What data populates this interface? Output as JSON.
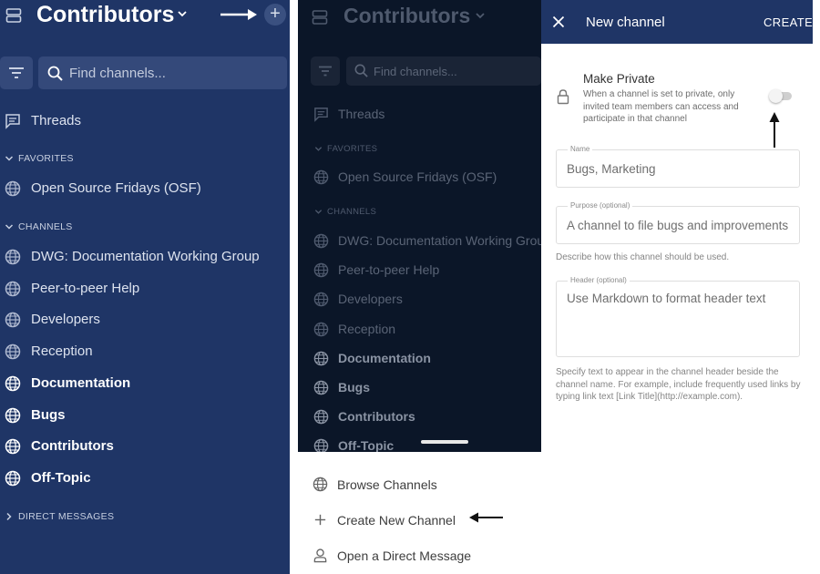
{
  "sidebar": {
    "team_name": "Contributors",
    "search_placeholder": "Find channels...",
    "threads_label": "Threads",
    "favorites_header": "FAVORITES",
    "favorites": [
      {
        "label": "Open Source Fridays (OSF)",
        "bold": false
      }
    ],
    "channels_header": "CHANNELS",
    "channels": [
      {
        "label": "DWG: Documentation Working Group",
        "bold": false
      },
      {
        "label": "Peer-to-peer Help",
        "bold": false
      },
      {
        "label": "Developers",
        "bold": false
      },
      {
        "label": "Reception",
        "bold": false
      },
      {
        "label": "Documentation",
        "bold": true
      },
      {
        "label": "Bugs",
        "bold": true
      },
      {
        "label": "Contributors",
        "bold": true
      },
      {
        "label": "Off-Topic",
        "bold": true
      }
    ],
    "direct_messages_header": "DIRECT MESSAGES"
  },
  "sheet": {
    "browse_channels": "Browse Channels",
    "create_new_channel": "Create New Channel",
    "open_direct_message": "Open a Direct Message"
  },
  "new_channel": {
    "title": "New channel",
    "create_label": "CREATE",
    "make_private_title": "Make Private",
    "make_private_desc": "When a channel is set to private, only invited team members can access and participate in that channel",
    "make_private_enabled": false,
    "name_label": "Name",
    "name_placeholder": "Bugs, Marketing",
    "purpose_label": "Purpose (optional)",
    "purpose_placeholder": "A channel to file bugs and improvements",
    "purpose_help": "Describe how this channel should be used.",
    "header_label": "Header (optional)",
    "header_placeholder": "Use Markdown to format header text",
    "header_help": "Specify text to appear in the channel header beside the channel name. For example, include frequently used links by typing link text [Link Title](http://example.com)."
  },
  "colors": {
    "sidebar_bg": "#1f3566",
    "dim_bg": "#0b1628",
    "header_bg": "#1f3566"
  }
}
